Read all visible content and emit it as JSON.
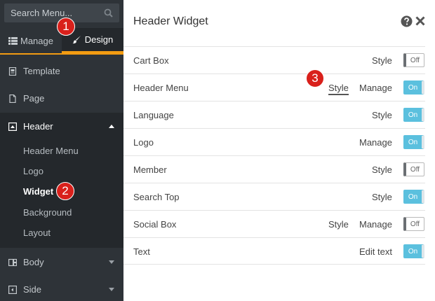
{
  "sidebar": {
    "search_placeholder": "Search Menu...",
    "tabs": {
      "manage": "Manage",
      "design": "Design"
    },
    "items": {
      "template": "Template",
      "page": "Page",
      "header": "Header",
      "body": "Body",
      "side": "Side"
    },
    "header_submenu": [
      "Header Menu",
      "Logo",
      "Widget",
      "Background",
      "Layout"
    ]
  },
  "badges": [
    "1",
    "2",
    "3"
  ],
  "panel": {
    "title": "Header Widget",
    "rows": [
      {
        "label": "Cart Box",
        "actions": [
          "Style"
        ],
        "toggle": "Off"
      },
      {
        "label": "Header Menu",
        "actions": [
          "Style",
          "Manage"
        ],
        "toggle": "On"
      },
      {
        "label": "Language",
        "actions": [
          "Style"
        ],
        "toggle": "On"
      },
      {
        "label": "Logo",
        "actions": [
          "Manage"
        ],
        "toggle": "On"
      },
      {
        "label": "Member",
        "actions": [
          "Style"
        ],
        "toggle": "Off"
      },
      {
        "label": "Search Top",
        "actions": [
          "Style"
        ],
        "toggle": "On"
      },
      {
        "label": "Social Box",
        "actions": [
          "Style",
          "Manage"
        ],
        "toggle": "Off"
      },
      {
        "label": "Text",
        "actions": [
          "Edit text"
        ],
        "toggle": "On"
      }
    ]
  },
  "colors": {
    "sidebar_bg": "#2e3338",
    "sidebar_active_bg": "#24282c",
    "accent_orange": "#f39c12",
    "badge_red": "#d9201b",
    "toggle_on": "#5bc0de"
  }
}
